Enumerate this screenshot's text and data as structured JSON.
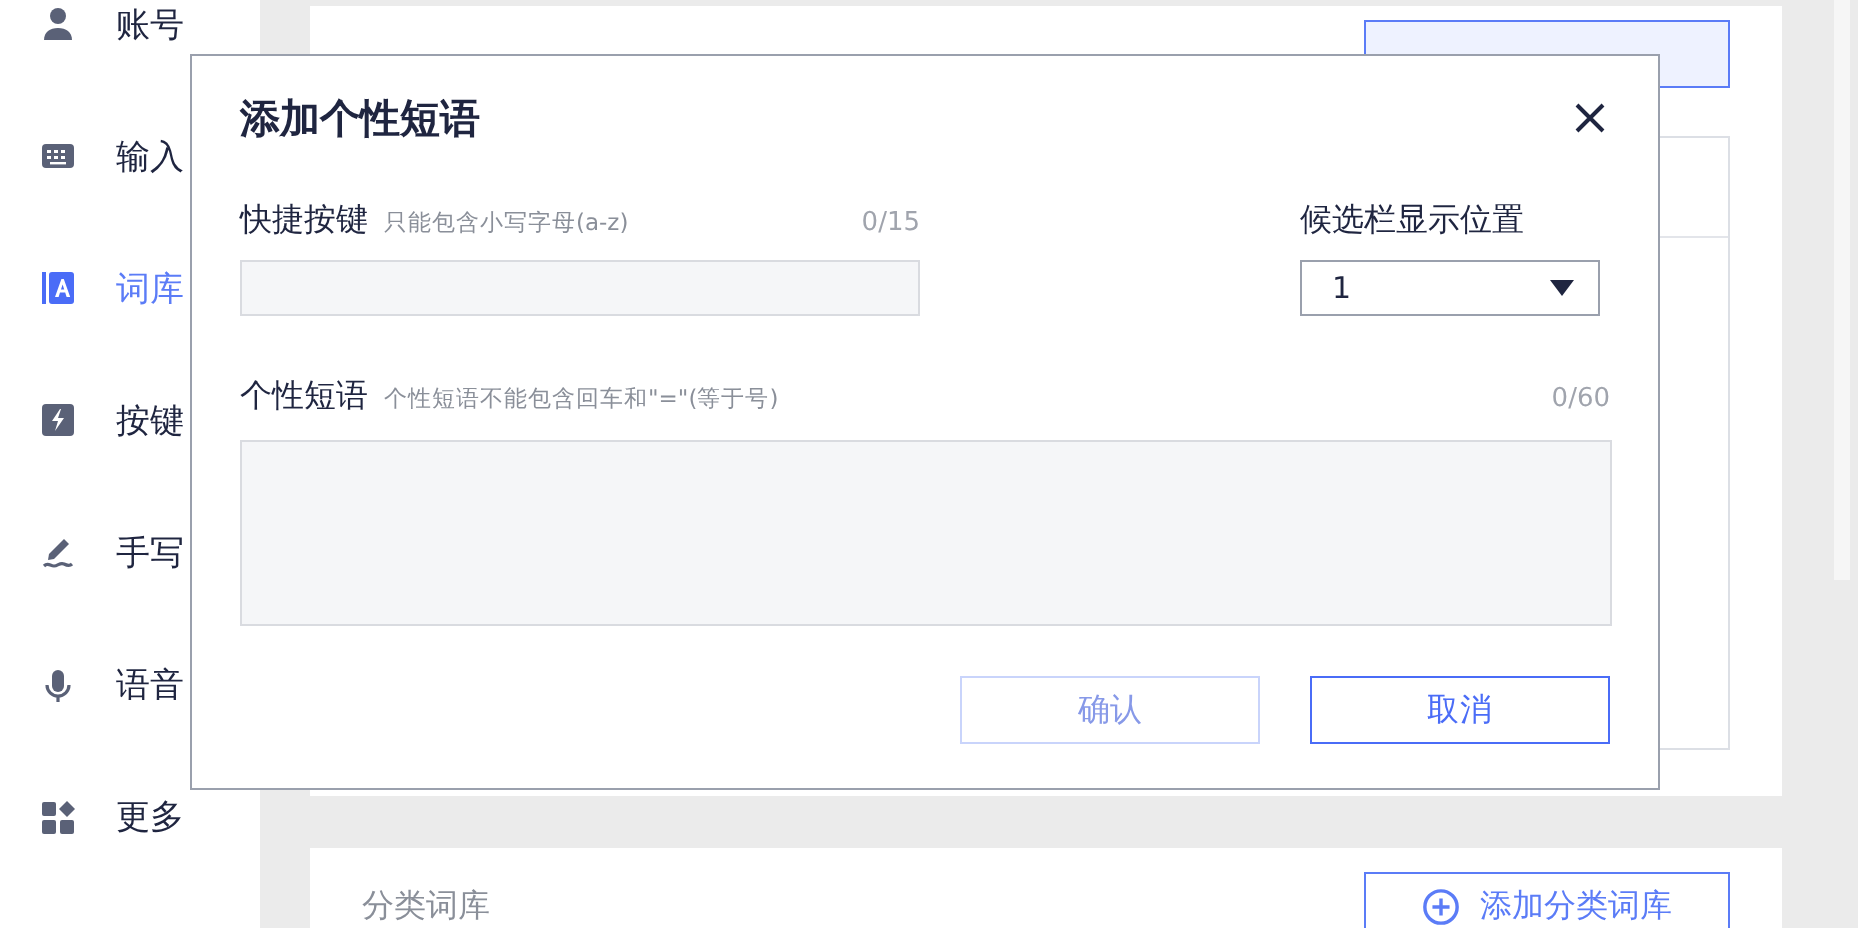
{
  "sidebar": {
    "items": [
      {
        "label": "账号",
        "selected": false
      },
      {
        "label": "输入",
        "selected": false
      },
      {
        "label": "词库",
        "selected": true
      },
      {
        "label": "按键",
        "selected": false
      },
      {
        "label": "手写",
        "selected": false
      },
      {
        "label": "语音",
        "selected": false
      },
      {
        "label": "更多",
        "selected": false
      }
    ]
  },
  "phrases_section": {
    "kind": "covered"
  },
  "categories_section": {
    "title": "分类词库",
    "add_button": "添加分类词库"
  },
  "dialog": {
    "title": "添加个性短语",
    "shortcut": {
      "label": "快捷按键",
      "hint": "只能包含小写字母(a-z)",
      "counter": "0/15"
    },
    "position": {
      "label": "候选栏显示位置",
      "value": "1"
    },
    "phrase": {
      "label": "个性短语",
      "hint": "个性短语不能包含回车和\"=\"(等于号)",
      "counter": "0/60"
    },
    "buttons": [
      {
        "label": "确认",
        "kind": "confirm",
        "disabled": true
      },
      {
        "label": "取消",
        "kind": "cancel",
        "disabled": false
      }
    ]
  }
}
